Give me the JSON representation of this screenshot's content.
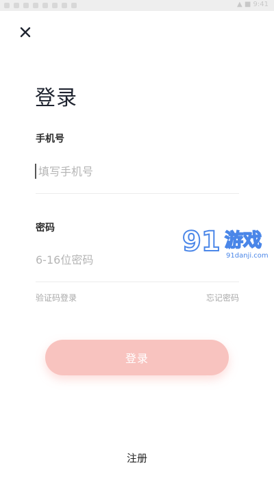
{
  "status_bar": {
    "text": "▲ ■ 9:41"
  },
  "header": {
    "close_icon": "close-icon"
  },
  "page": {
    "title": "登录"
  },
  "form": {
    "phone_label": "手机号",
    "phone_placeholder": "填写手机号",
    "password_label": "密码",
    "password_placeholder": "6-16位密码",
    "sms_login_link": "验证码登录",
    "forgot_password_link": "忘记密码"
  },
  "actions": {
    "login_button": "登录",
    "register_link": "注册"
  },
  "watermark": {
    "logo_text": "91游戏",
    "logo_url_text": "91danji.com"
  },
  "colors": {
    "accent": "#f8c3bf",
    "text_dark": "#1f2430",
    "placeholder": "#b5b5b5",
    "link": "#a8a8a8",
    "watermark": "#4a86e8"
  }
}
